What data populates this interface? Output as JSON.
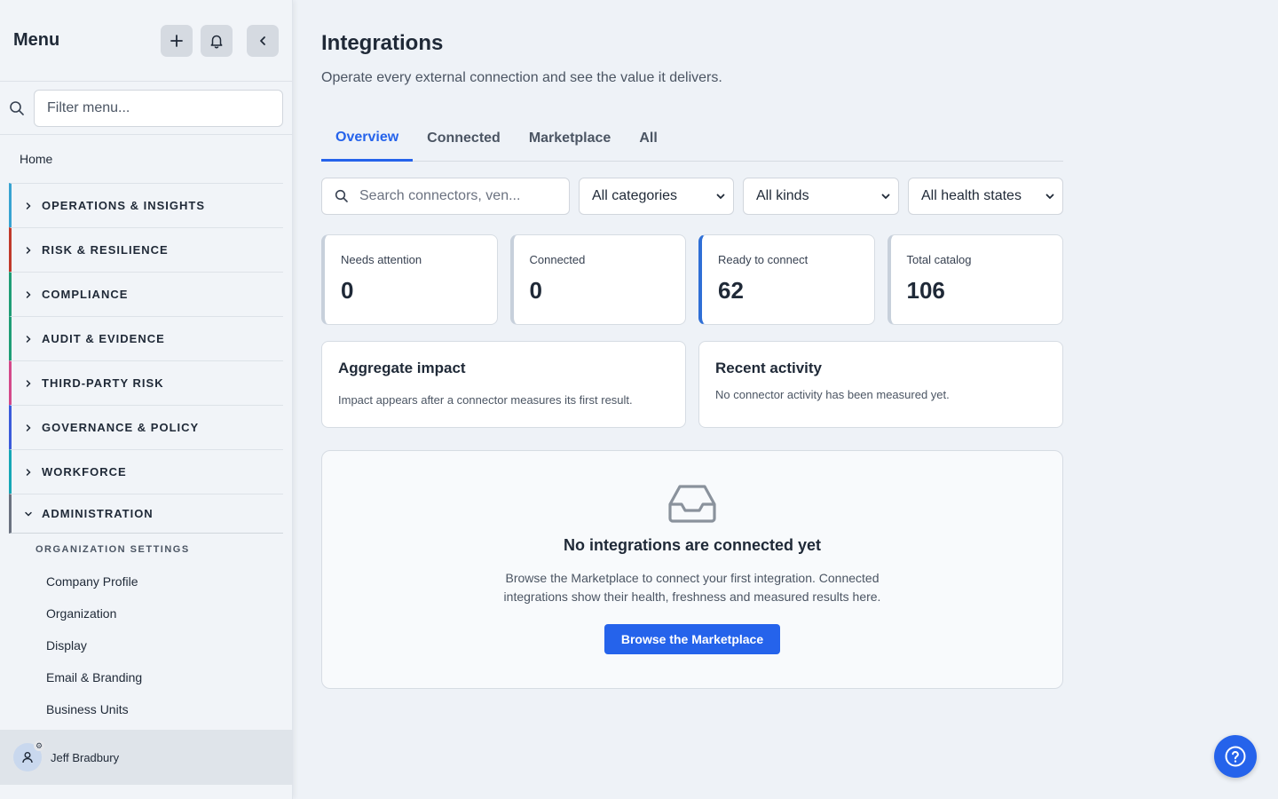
{
  "sidebar": {
    "title": "Menu",
    "filter_placeholder": "Filter menu...",
    "home": "Home",
    "sections": [
      {
        "label": "OPERATIONS & INSIGHTS",
        "color": "#38a3d1"
      },
      {
        "label": "RISK & RESILIENCE",
        "color": "#c0392b"
      },
      {
        "label": "COMPLIANCE",
        "color": "#1f9d76"
      },
      {
        "label": "AUDIT & EVIDENCE",
        "color": "#1f9d76"
      },
      {
        "label": "THIRD-PARTY RISK",
        "color": "#d44a8a"
      },
      {
        "label": "GOVERNANCE & POLICY",
        "color": "#3b5bdb"
      },
      {
        "label": "WORKFORCE",
        "color": "#16a6b6"
      },
      {
        "label": "ADMINISTRATION",
        "color": "#6b7280"
      }
    ],
    "sub_header": "ORGANIZATION SETTINGS",
    "sub_items": [
      "Company Profile",
      "Organization",
      "Display",
      "Email & Branding",
      "Business Units"
    ],
    "user_name": "Jeff Bradbury"
  },
  "page": {
    "title": "Integrations",
    "subtitle": "Operate every external connection and see the value it delivers."
  },
  "tabs": [
    "Overview",
    "Connected",
    "Marketplace",
    "All"
  ],
  "filters": {
    "search_placeholder": "Search connectors, ven...",
    "category": "All categories",
    "kind": "All kinds",
    "health": "All health states"
  },
  "stats": [
    {
      "label": "Needs attention",
      "value": "0"
    },
    {
      "label": "Connected",
      "value": "0"
    },
    {
      "label": "Ready to connect",
      "value": "62"
    },
    {
      "label": "Total catalog",
      "value": "106"
    }
  ],
  "panels": {
    "impact_title": "Aggregate impact",
    "impact_text": "Impact appears after a connector measures its first result.",
    "activity_title": "Recent activity",
    "activity_text": "No connector activity has been measured yet."
  },
  "empty_state": {
    "title": "No integrations are connected yet",
    "text": "Browse the Marketplace to connect your first integration. Connected integrations show their health, freshness and measured results here.",
    "button": "Browse the Marketplace"
  },
  "colors": {
    "accent": "#2563eb"
  }
}
